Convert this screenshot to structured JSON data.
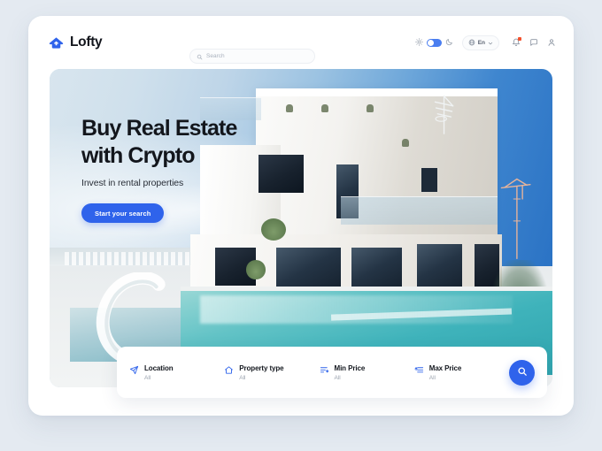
{
  "brand": {
    "name": "Lofty",
    "logo_icon": "house-icon",
    "accent_color": "#2f63eb"
  },
  "header": {
    "search": {
      "placeholder": "Search",
      "value": "",
      "icon": "search-icon"
    },
    "theme_toggle": {
      "sun_icon": "sun-icon",
      "moon_icon": "moon-icon",
      "state": "light",
      "track_color": "#4a7ef0"
    },
    "language": {
      "icon": "globe-icon",
      "label": "En",
      "chevron": "chevron-down-icon"
    },
    "actions": [
      {
        "name": "notifications-icon",
        "has_badge": true,
        "badge_color": "#f4512c"
      },
      {
        "name": "messages-icon",
        "has_badge": false
      },
      {
        "name": "account-icon",
        "has_badge": false
      }
    ]
  },
  "hero": {
    "title_line_1": "Buy Real Estate",
    "title_line_2": "with Crypto",
    "subtitle": "Invest in rental properties",
    "cta_label": "Start your search",
    "image_alt": "Modern white villa with swimming pool under blue sky"
  },
  "filter_bar": {
    "fields": [
      {
        "label": "Location",
        "value": "All",
        "icon": "location-send-icon"
      },
      {
        "label": "Property type",
        "value": "All",
        "icon": "home-icon"
      },
      {
        "label": "Min Price",
        "value": "All",
        "icon": "sort-descending-icon"
      },
      {
        "label": "Max Price",
        "value": "All",
        "icon": "sort-ascending-icon"
      }
    ],
    "submit_icon": "search-icon"
  }
}
